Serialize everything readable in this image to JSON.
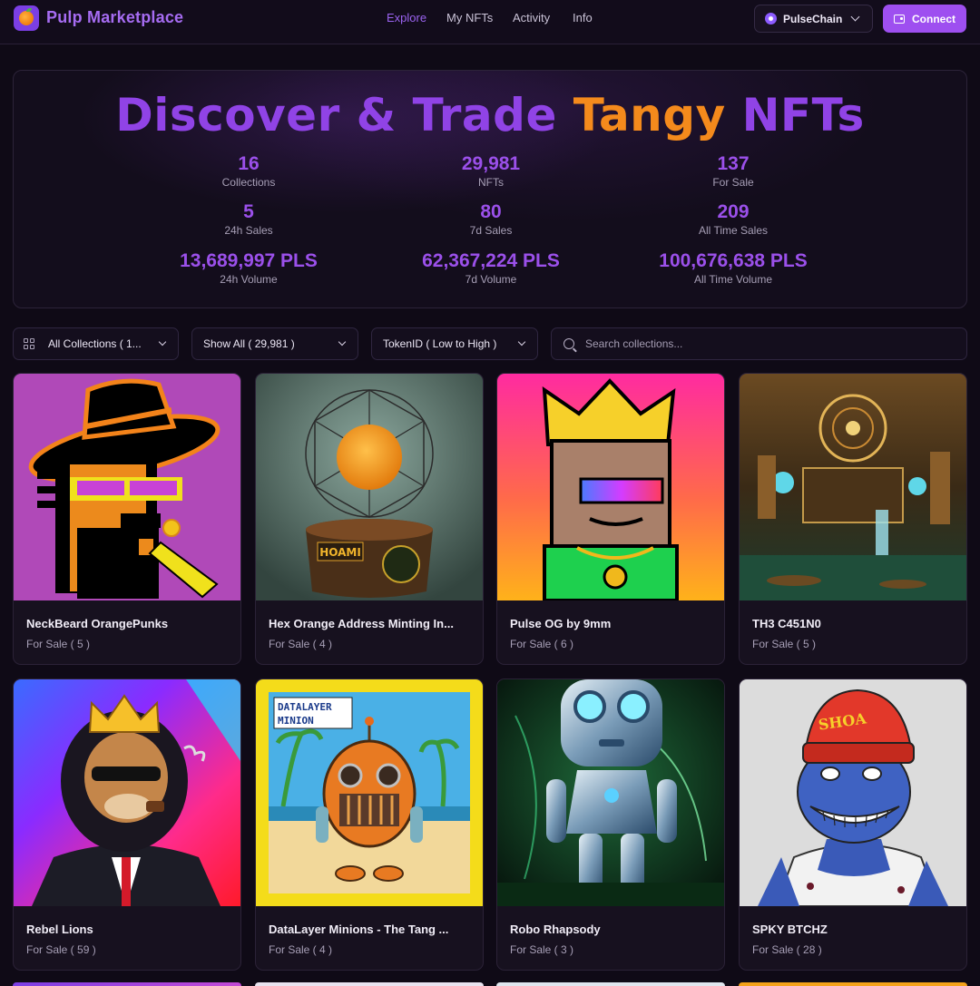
{
  "nav": {
    "brand": "Pulp Marketplace",
    "links": [
      "Explore",
      "My NFTs",
      "Activity",
      "Info"
    ],
    "chain": "PulseChain",
    "connect": "Connect"
  },
  "hero": {
    "title_part1": "Discover & Trade ",
    "title_highlight": "Tangy",
    "title_part2": " NFTs",
    "stats": [
      {
        "value": "16",
        "label": "Collections"
      },
      {
        "value": "29,981",
        "label": "NFTs"
      },
      {
        "value": "137",
        "label": "For Sale"
      },
      {
        "value": "5",
        "label": "24h Sales"
      },
      {
        "value": "80",
        "label": "7d Sales"
      },
      {
        "value": "209",
        "label": "All Time Sales"
      },
      {
        "value": "13,689,997 PLS",
        "label": "24h Volume"
      },
      {
        "value": "62,367,224 PLS",
        "label": "7d Volume"
      },
      {
        "value": "100,676,638 PLS",
        "label": "All Time Volume"
      }
    ]
  },
  "filters": {
    "collections": "All Collections ( 1...",
    "show": "Show All ( 29,981 )",
    "sort": "TokenID ( Low to High )",
    "search_placeholder": "Search collections..."
  },
  "cards": [
    {
      "name": "NeckBeard OrangePunks",
      "sale": "For Sale ( 5 )"
    },
    {
      "name": "Hex Orange Address Minting In...",
      "sale": "For Sale ( 4 )"
    },
    {
      "name": "Pulse OG by 9mm",
      "sale": "For Sale ( 6 )"
    },
    {
      "name": "TH3 C451N0",
      "sale": "For Sale ( 5 )"
    },
    {
      "name": "Rebel Lions",
      "sale": "For Sale ( 59 )"
    },
    {
      "name": "DataLayer Minions - The Tang ...",
      "sale": "For Sale ( 4 )"
    },
    {
      "name": "Robo Rhapsody",
      "sale": "For Sale ( 3 )"
    },
    {
      "name": "SPKY BTCHZ",
      "sale": "For Sale ( 28 )"
    }
  ],
  "art_text": {
    "hoami": "HOAMI",
    "datalayer_title_1": "DATALAYER",
    "datalayer_title_2": "MINION",
    "shoa": "SHOA"
  },
  "colors": {
    "accent": "#9e4ff0",
    "brand_purple": "#9043e6",
    "brand_orange": "#f48a1c",
    "background": "#0f0a16"
  }
}
